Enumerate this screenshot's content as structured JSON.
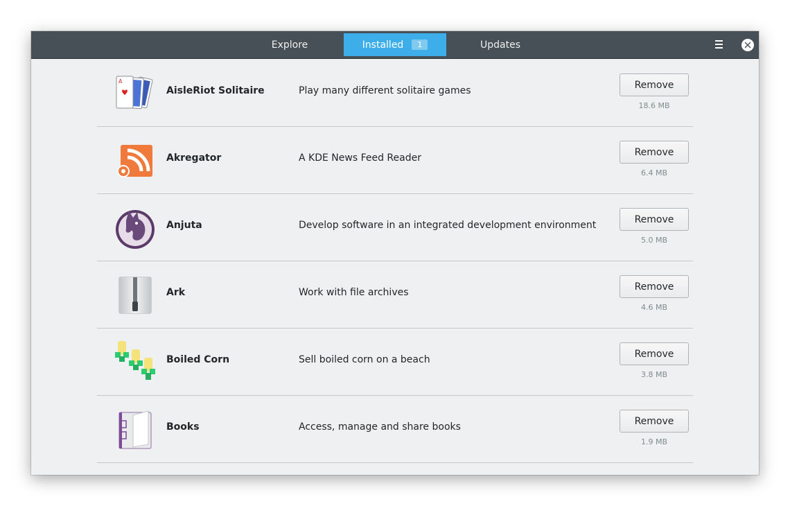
{
  "tabs": {
    "explore": "Explore",
    "installed": "Installed",
    "installed_count": "1",
    "updates": "Updates"
  },
  "colors": {
    "titlebar": "#475057",
    "accent": "#3daee9",
    "background": "#eff0f1"
  },
  "icons": {
    "menu": "hamburger-icon",
    "close": "close-icon"
  },
  "apps": [
    {
      "name": "AisleRiot Solitaire",
      "description": "Play many different solitaire games",
      "action": "Remove",
      "size": "18.6 MB",
      "icon": "cards-icon"
    },
    {
      "name": "Akregator",
      "description": "A KDE News Feed Reader",
      "action": "Remove",
      "size": "6.4 MB",
      "icon": "rss-icon"
    },
    {
      "name": "Anjuta",
      "description": "Develop software in an integrated development environment",
      "action": "Remove",
      "size": "5.0 MB",
      "icon": "horse-icon"
    },
    {
      "name": "Ark",
      "description": "Work with file archives",
      "action": "Remove",
      "size": "4.6 MB",
      "icon": "zip-archive-icon"
    },
    {
      "name": "Boiled Corn",
      "description": "Sell boiled corn on a beach",
      "action": "Remove",
      "size": "3.8 MB",
      "icon": "corn-icon"
    },
    {
      "name": "Books",
      "description": "Access, manage and share books",
      "action": "Remove",
      "size": "1.9 MB",
      "icon": "book-icon"
    }
  ]
}
